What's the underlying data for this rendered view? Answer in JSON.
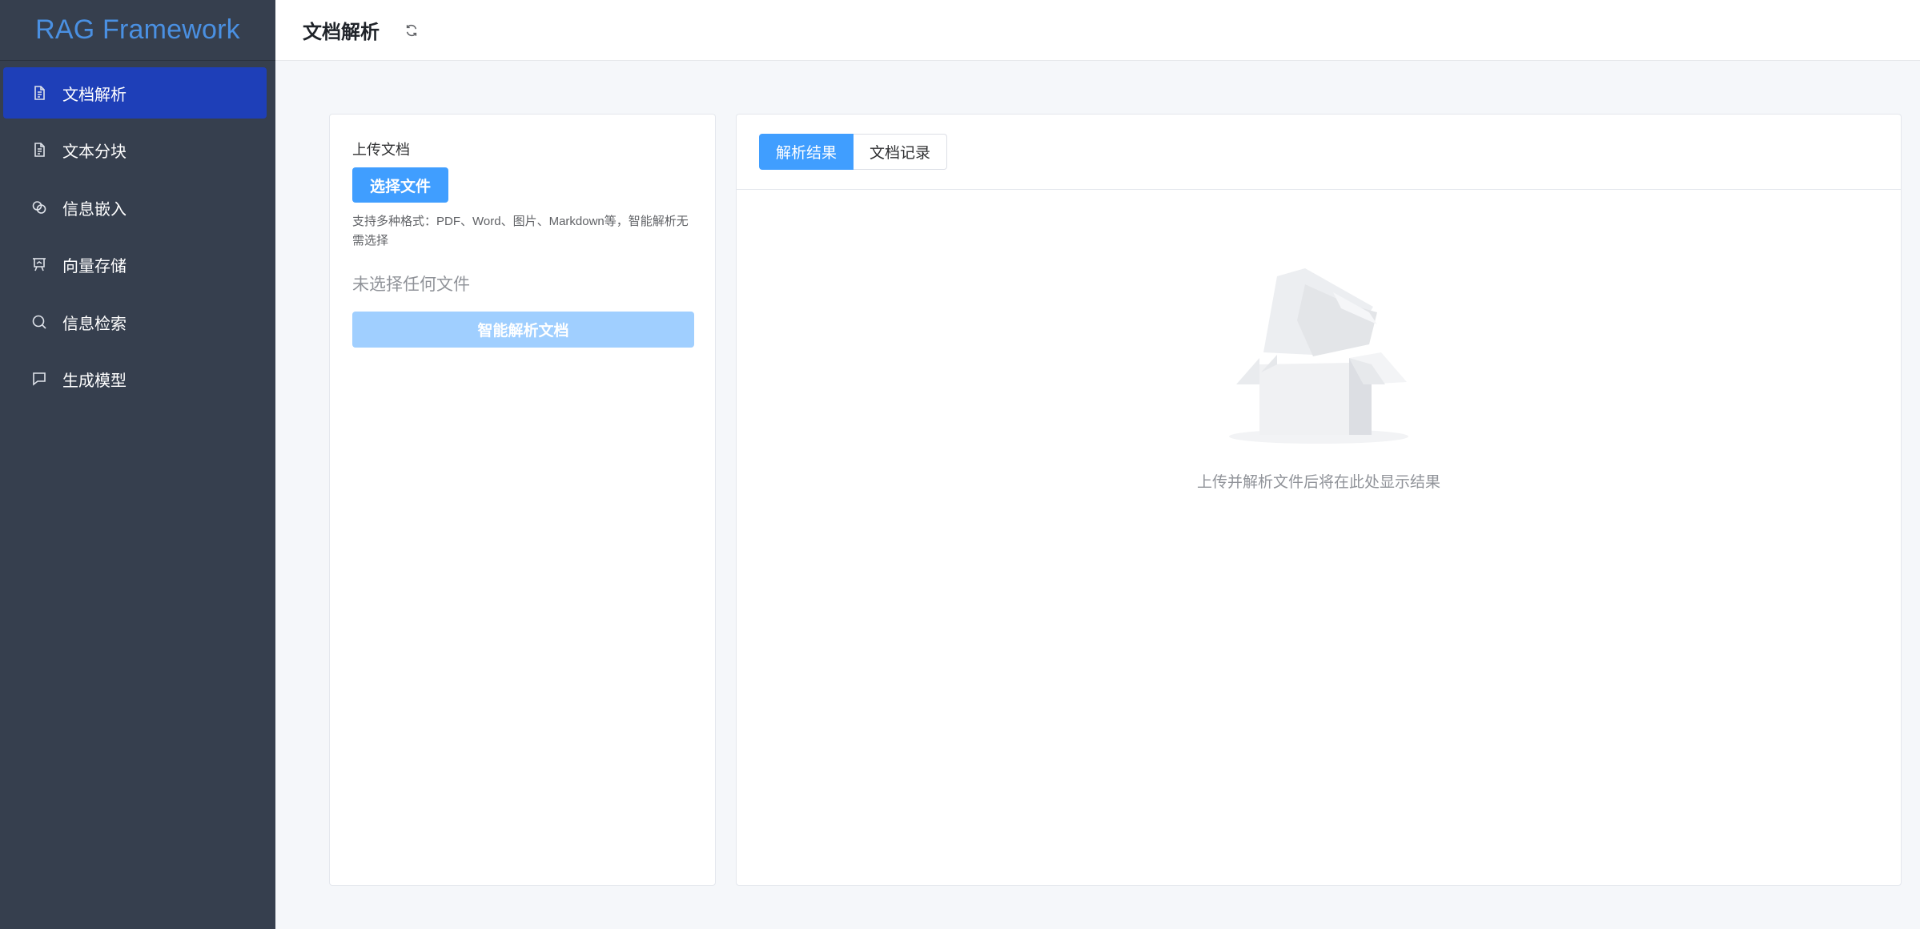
{
  "brand": {
    "title": "RAG Framework"
  },
  "sidebar": {
    "items": [
      {
        "label": "文档解析",
        "icon": "document-icon",
        "active": true
      },
      {
        "label": "文本分块",
        "icon": "document-icon",
        "active": false
      },
      {
        "label": "信息嵌入",
        "icon": "connection-icon",
        "active": false
      },
      {
        "label": "向量存储",
        "icon": "data-board-icon",
        "active": false
      },
      {
        "label": "信息检索",
        "icon": "search-icon",
        "active": false
      },
      {
        "label": "生成模型",
        "icon": "chat-icon",
        "active": false
      }
    ]
  },
  "header": {
    "title": "文档解析",
    "refresh_icon": "refresh-icon"
  },
  "upload": {
    "label": "上传文档",
    "choose_button": "选择文件",
    "hint": "支持多种格式：PDF、Word、图片、Markdown等，智能解析无需选择",
    "no_file_text": "未选择任何文件",
    "parse_button": "智能解析文档"
  },
  "results": {
    "tabs": [
      {
        "label": "解析结果",
        "active": true
      },
      {
        "label": "文档记录",
        "active": false
      }
    ],
    "empty_text": "上传并解析文件后将在此处显示结果",
    "empty_icon": "empty-box-icon"
  },
  "colors": {
    "sidebar_bg": "#363f4e",
    "active_menu": "#1e3fb8",
    "brand": "#4a90e2",
    "primary": "#409eff",
    "primary_disabled": "#a0cfff"
  }
}
